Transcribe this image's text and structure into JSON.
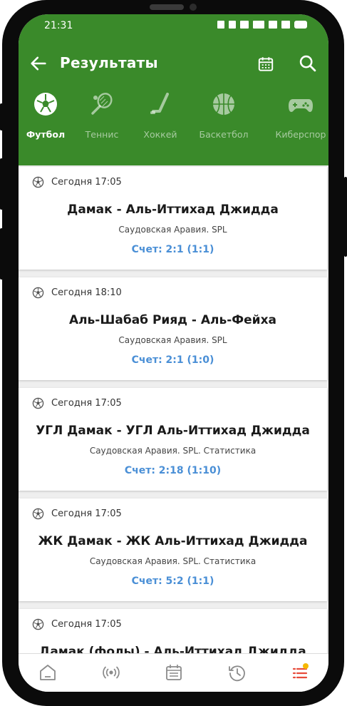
{
  "status_bar": {
    "time": "21:31"
  },
  "header": {
    "title": "Результаты"
  },
  "sports_tabs": [
    {
      "label": "Футбол",
      "icon": "soccer-ball-icon",
      "active": true
    },
    {
      "label": "Теннис",
      "icon": "tennis-racket-icon",
      "active": false
    },
    {
      "label": "Хоккей",
      "icon": "hockey-stick-icon",
      "active": false
    },
    {
      "label": "Баскетбол",
      "icon": "basketball-icon",
      "active": false
    },
    {
      "label": "Киберспор",
      "icon": "gamepad-icon",
      "active": false
    }
  ],
  "matches": [
    {
      "time": "Сегодня 17:05",
      "teams": "Дамак - Аль-Иттихад Джидда",
      "league": "Саудовская Аравия. SPL",
      "score": "Счет: 2:1 (1:1)"
    },
    {
      "time": "Сегодня 18:10",
      "teams": "Аль-Шабаб Рияд - Аль-Фейха",
      "league": "Саудовская Аравия. SPL",
      "score": "Счет: 2:1 (1:0)"
    },
    {
      "time": "Сегодня 17:05",
      "teams": "УГЛ Дамак - УГЛ Аль-Иттихад Джидда",
      "league": "Саудовская Аравия. SPL. Статистика",
      "score": "Счет: 2:18 (1:10)"
    },
    {
      "time": "Сегодня 17:05",
      "teams": "ЖК Дамак - ЖК Аль-Иттихад Джидда",
      "league": "Саудовская Аравия. SPL. Статистика",
      "score": "Счет: 5:2 (1:1)"
    },
    {
      "time": "Сегодня 17:05",
      "teams": "Дамак (фолы) - Аль-Иттихад Джидда",
      "league": "",
      "score": ""
    }
  ],
  "bottom_nav": [
    {
      "icon": "home-icon"
    },
    {
      "icon": "live-broadcast-icon"
    },
    {
      "icon": "calendar-icon"
    },
    {
      "icon": "history-icon"
    },
    {
      "icon": "bet-slip-list-icon",
      "badge_color": "#f5b800",
      "active_color": "#e74c3c"
    }
  ],
  "colors": {
    "brand_green": "#3a8a2a",
    "score_blue": "#4a8fd6",
    "nav_gray": "#8a8a8a"
  }
}
